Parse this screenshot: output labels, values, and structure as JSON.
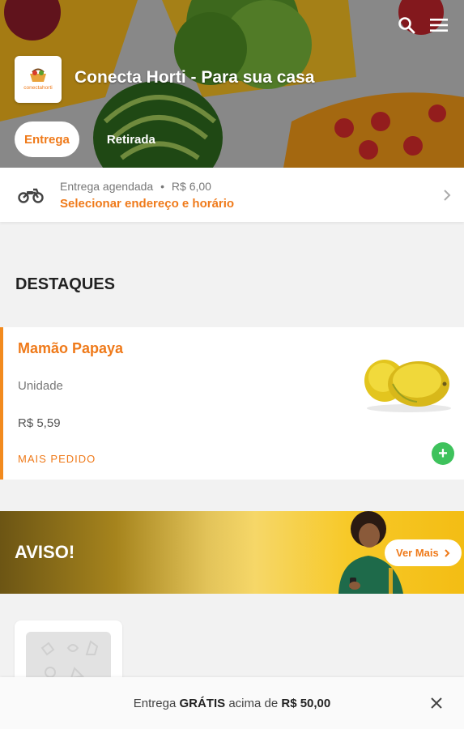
{
  "header": {
    "store_name": "Conecta Horti - Para sua casa",
    "logo_text": "conectahorti",
    "tabs": [
      {
        "label": "Entrega",
        "active": true
      },
      {
        "label": "Retirada",
        "active": false
      }
    ],
    "icons": [
      "search-icon",
      "menu-icon"
    ]
  },
  "delivery": {
    "type_label": "Entrega agendada",
    "separator": "•",
    "fee": "R$ 6,00",
    "action_label": "Selecionar endereço e horário",
    "icon": "motorcycle-icon"
  },
  "highlights": {
    "title": "DESTAQUES",
    "product": {
      "name": "Mamão Papaya",
      "unit": "Unidade",
      "price": "R$ 5,59",
      "badge": "MAIS PEDIDO",
      "add_symbol": "+"
    }
  },
  "banner": {
    "title": "AVISO!",
    "button_label": "Ver Mais"
  },
  "bottom_bar": {
    "prefix": "Entrega",
    "bold_word": "GRÁTIS",
    "middle": "acima de",
    "amount": "R$ 50,00"
  },
  "colors": {
    "accent": "#ef7a1a",
    "add_button": "#3ec25c",
    "banner_gold": "#f3bd14"
  }
}
